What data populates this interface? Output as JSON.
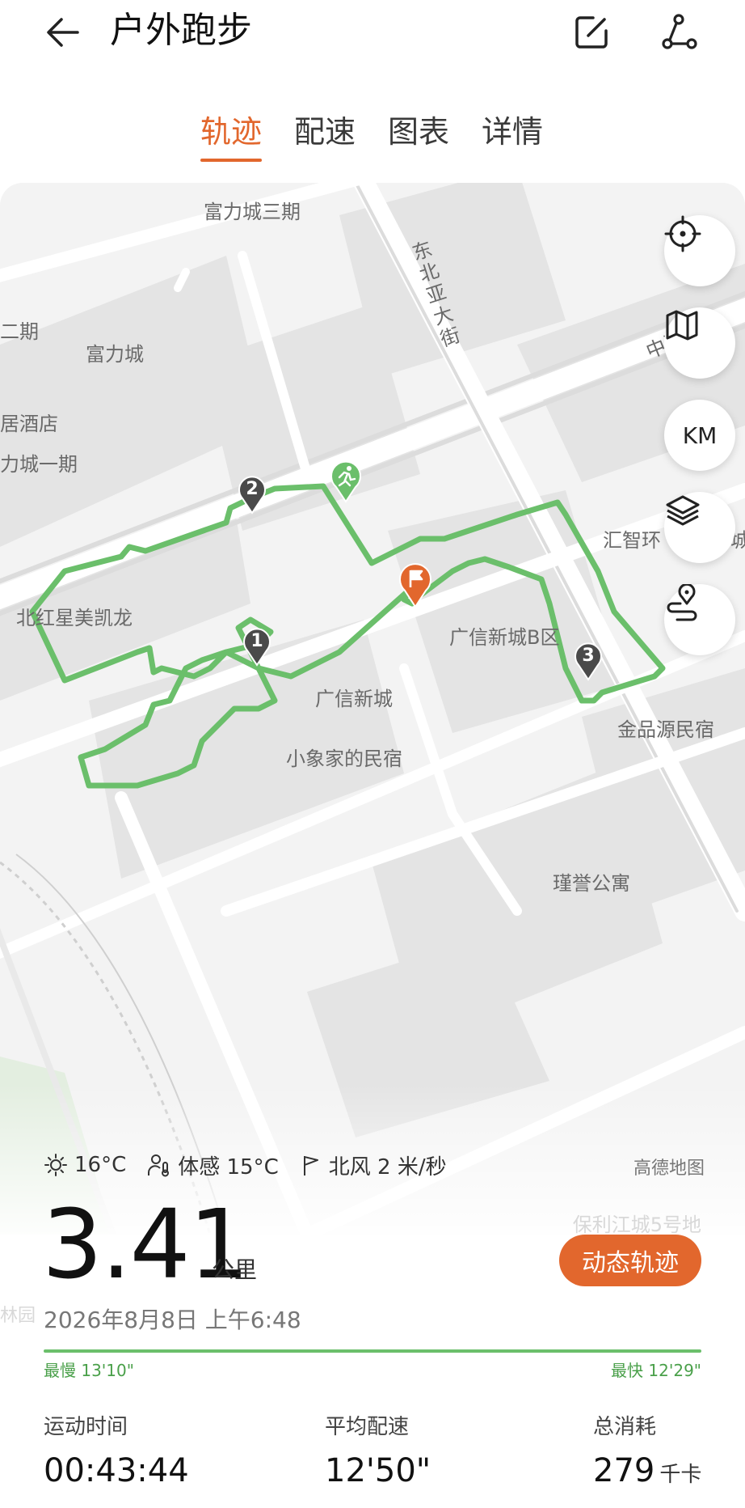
{
  "header": {
    "title": "户外跑步"
  },
  "tabs": [
    {
      "label": "轨迹"
    },
    {
      "label": "配速"
    },
    {
      "label": "图表"
    },
    {
      "label": "详情"
    }
  ],
  "map": {
    "labels": {
      "fuli_phase3": "富力城三期",
      "phase2": "二期",
      "fuli": "富力城",
      "hotel": "居酒店",
      "fuli_phase1": "力城一期",
      "dongbeiya": "东北亚大街",
      "zhongyuan": "中源",
      "huizhi": "汇智环",
      "huizhi_tail": "城",
      "redstar": "北红星美凯龙",
      "guangxin_b": "广信新城B区",
      "guangxin": "广信新城",
      "jinpin": "金品源民宿",
      "xiaoxiang": "小象家的民宿",
      "jinyu": "瑾誉公寓",
      "baoli": "保利江城5号地",
      "park": "林园"
    },
    "controls": {
      "km": "KM"
    },
    "markers": [
      "1",
      "2",
      "3"
    ]
  },
  "weather": {
    "temperature": "16°C",
    "feels_like": "体感 15°C",
    "wind": "北风 2 米/秒"
  },
  "map_credit": "高德地图",
  "summary": {
    "distance": "3.41",
    "distance_unit": "公里",
    "replay_label": "动态轨迹",
    "datetime": "2026年8月8日 上午6:48",
    "slowest": "最慢 13'10\"",
    "fastest": "最快 12'29\""
  },
  "stats": [
    {
      "label": "运动时间",
      "value": "00:43:44",
      "unit": ""
    },
    {
      "label": "平均配速",
      "value": "12'50\"",
      "unit": ""
    },
    {
      "label": "总消耗",
      "value": "279",
      "unit": "千卡"
    }
  ],
  "colors": {
    "accent": "#e2672d",
    "track": "#6bbf6b"
  }
}
